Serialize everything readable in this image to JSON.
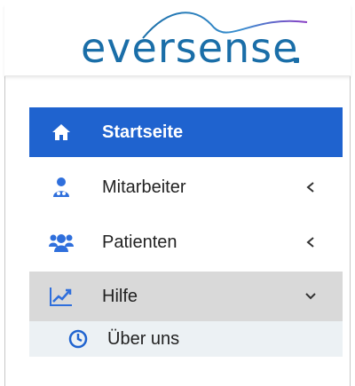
{
  "brand": {
    "logo_text": "eversense",
    "color": "#1a6ea8"
  },
  "menu": {
    "items": [
      {
        "label": "Startseite",
        "icon": "home-icon",
        "state": "active"
      },
      {
        "label": "Mitarbeiter",
        "icon": "user-doctor-icon",
        "state": "collapsed",
        "chevron": "chevron-left-icon"
      },
      {
        "label": "Patienten",
        "icon": "users-icon",
        "state": "collapsed",
        "chevron": "chevron-left-icon"
      },
      {
        "label": "Hilfe",
        "icon": "chart-line-icon",
        "state": "expanded",
        "chevron": "chevron-down-icon"
      }
    ],
    "submenu": [
      {
        "label": "Über uns",
        "icon": "clock-icon"
      }
    ]
  },
  "colors": {
    "active_bg": "#1f63cf",
    "icon_blue": "#2f6fdc",
    "expanded_bg": "#d9d9d9",
    "submenu_bg": "#ecf1f4"
  }
}
